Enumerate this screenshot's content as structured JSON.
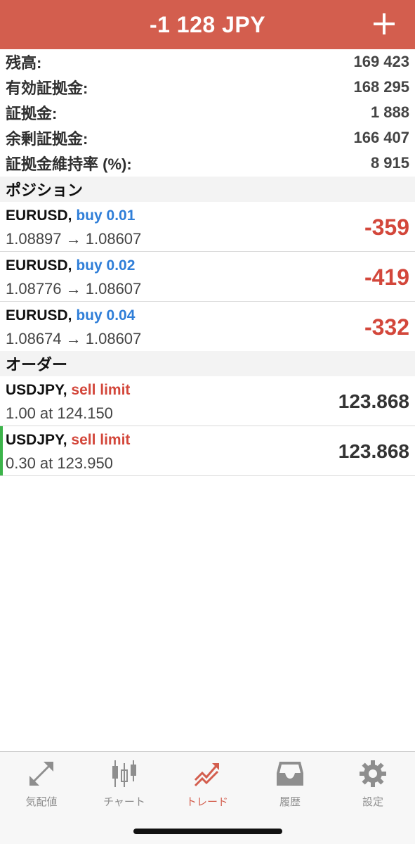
{
  "header": {
    "title": "-1 128 JPY",
    "add_icon": "plus-icon",
    "color": "#d35e4e"
  },
  "summary": [
    {
      "label": "残高:",
      "value": "169 423"
    },
    {
      "label": "有効証拠金:",
      "value": "168 295"
    },
    {
      "label": "証拠金:",
      "value": "1 888"
    },
    {
      "label": "余剰証拠金:",
      "value": "166 407"
    },
    {
      "label": "証拠金維持率 (%):",
      "value": "8 915"
    }
  ],
  "positions": {
    "title": "ポジション",
    "items": [
      {
        "symbol": "EURUSD,",
        "side": "buy 0.01",
        "prices": "1.08897 → 1.08607",
        "profit": "-359"
      },
      {
        "symbol": "EURUSD,",
        "side": "buy 0.02",
        "prices": "1.08776 → 1.08607",
        "profit": "-419"
      },
      {
        "symbol": "EURUSD,",
        "side": "buy 0.04",
        "prices": "1.08674 → 1.08607",
        "profit": "-332"
      }
    ]
  },
  "orders": {
    "title": "オーダー",
    "items": [
      {
        "symbol": "USDJPY,",
        "type": "sell limit",
        "detail": "1.00 at 124.150",
        "price": "123.868"
      },
      {
        "symbol": "USDJPY,",
        "type": "sell limit",
        "detail": "0.30 at 123.950",
        "price": "123.868",
        "selected": true
      }
    ]
  },
  "tabs": [
    {
      "label": "気配値",
      "icon": "quotes-icon"
    },
    {
      "label": "チャート",
      "icon": "chart-icon"
    },
    {
      "label": "トレード",
      "icon": "trade-icon",
      "active": true
    },
    {
      "label": "履歴",
      "icon": "history-icon"
    },
    {
      "label": "設定",
      "icon": "settings-icon"
    }
  ],
  "colors": {
    "accent": "#d35e4e",
    "buy": "#2f7ed8",
    "sell": "#d3473b",
    "selected_bar": "#3cb34a"
  }
}
